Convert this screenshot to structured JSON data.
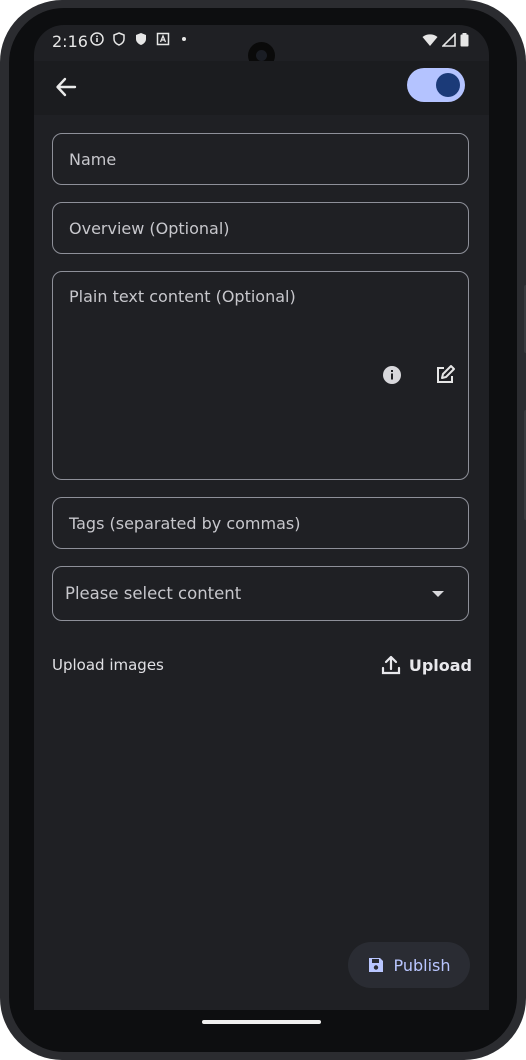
{
  "status_bar": {
    "time": "2:16",
    "icons": [
      "info-icon",
      "shield-icon",
      "shield-filled-icon",
      "a-box-icon"
    ],
    "right_icons": [
      "wifi-icon",
      "signal-icon",
      "battery-icon"
    ]
  },
  "app_bar": {
    "back_icon": "arrow-left-icon",
    "toggle_on": true
  },
  "form": {
    "name_placeholder": "Name",
    "overview_placeholder": "Overview (Optional)",
    "plain_text_placeholder": "Plain text content (Optional)",
    "tags_placeholder": "Tags (separated by commas)",
    "select_placeholder": "Please select content",
    "upload_label": "Upload images",
    "upload_button": "Upload",
    "publish_button": "Publish"
  },
  "colors": {
    "background": "#1f2024",
    "accent": "#b4c3ff",
    "toggle_knob": "#1b3a78"
  }
}
